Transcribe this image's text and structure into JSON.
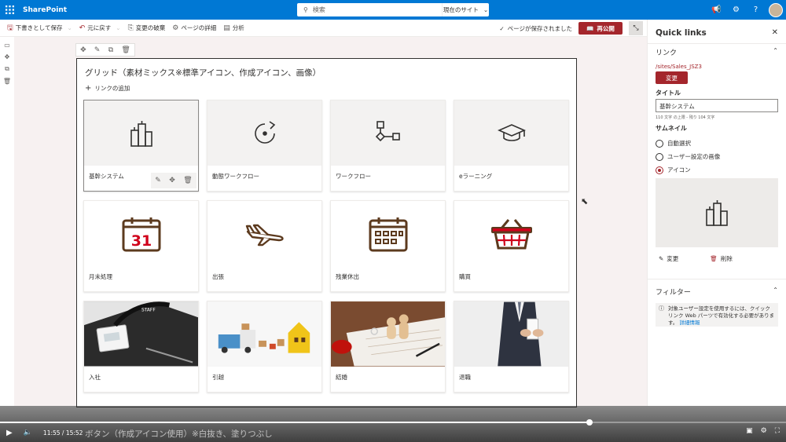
{
  "suitebar": {
    "brand": "SharePoint",
    "search_placeholder": "検索",
    "search_scope": "現在のサイト",
    "icons": [
      "waffle-icon",
      "megaphone-icon",
      "gear-icon",
      "help-icon",
      "avatar"
    ]
  },
  "cmdbar": {
    "save_draft": "下書きとして保存",
    "undo": "元に戻す",
    "discard": "変更の破棄",
    "page_details": "ページの詳細",
    "analytics": "分析",
    "saved_status": "ページが保存されました",
    "republish": "再公開"
  },
  "webpart": {
    "title": "グリッド（素材ミックス※標準アイコン、作成アイコン、画像）",
    "add_link": "リンクの追加",
    "tiles": [
      {
        "label": "基幹システム",
        "icon": "buildings-icon"
      },
      {
        "label": "動態ワークフロー",
        "icon": "rotate-arrow-icon"
      },
      {
        "label": "ワークフロー",
        "icon": "flowchart-icon"
      },
      {
        "label": "eラーニング",
        "icon": "graduation-cap-icon"
      },
      {
        "label": "月末処理",
        "icon": "calendar-31-icon",
        "calendar_day": "31"
      },
      {
        "label": "出張",
        "icon": "airplane-icon"
      },
      {
        "label": "残業休出",
        "icon": "calendar-grid-icon"
      },
      {
        "label": "購買",
        "icon": "shopping-basket-icon"
      },
      {
        "label": "入社",
        "icon": "id-card-photo"
      },
      {
        "label": "引越",
        "icon": "moving-truck-photo"
      },
      {
        "label": "結婚",
        "icon": "wedding-document-photo"
      },
      {
        "label": "退職",
        "icon": "resignation-letter-photo"
      }
    ]
  },
  "panel": {
    "title": "Quick links",
    "link_section": "リンク",
    "url": "/sites/Sales_JSZ3",
    "change_button": "変更",
    "title_label": "タイトル",
    "title_value": "基幹システム",
    "counter": "110 文字 の上限 - 残り 104 文字",
    "thumbnail_label": "サムネイル",
    "options": [
      "自動選択",
      "ユーザー設定の画像",
      "アイコン"
    ],
    "selected_option": 2,
    "change_action": "変更",
    "delete_action": "削除",
    "filter_section": "フィルター",
    "info_text": "対象ユーザー設定を使用するには、クイック リンク Web パーツで有効化する必要があります。",
    "info_link": "詳細情報"
  },
  "video": {
    "current_time": "11:55",
    "duration": "15:52",
    "progress": 0.75,
    "subtitle": "ボタン（作成アイコン使用）※白抜き、塗りつぶし"
  },
  "colors": {
    "brand_blue": "#0078d4",
    "accent_red": "#a4262c"
  }
}
